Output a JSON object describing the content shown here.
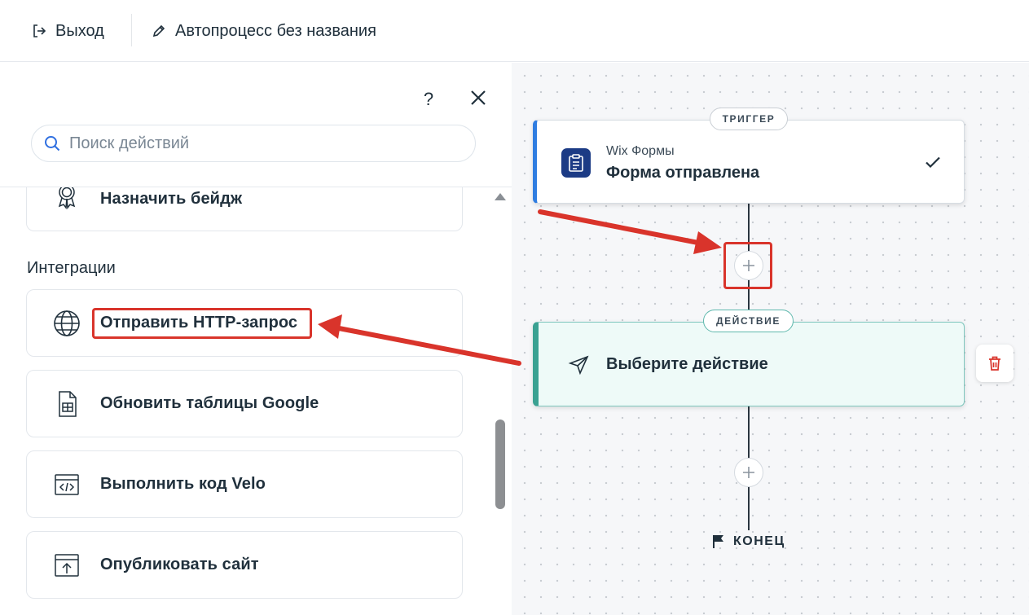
{
  "topbar": {
    "exit_label": "Выход",
    "title": "Автопроцесс без названия"
  },
  "panel": {
    "help_label": "?",
    "search": {
      "placeholder": "Поиск действий",
      "value": ""
    },
    "items_top": [
      {
        "label": "Назначить бейдж",
        "icon": "badge-icon"
      }
    ],
    "section_integrations": "Интеграции",
    "integrations": [
      {
        "label": "Отправить HTTP-запрос",
        "icon": "globe-icon",
        "highlighted": true
      },
      {
        "label": "Обновить таблицы Google",
        "icon": "sheet-icon"
      },
      {
        "label": "Выполнить код Velo",
        "icon": "code-icon"
      },
      {
        "label": "Опубликовать сайт",
        "icon": "publish-icon"
      }
    ]
  },
  "canvas": {
    "trigger": {
      "pill": "ТРИГГЕР",
      "app": "Wix Формы",
      "title": "Форма отправлена"
    },
    "action": {
      "pill": "ДЕЙСТВИЕ",
      "title": "Выберите действие"
    },
    "end_label": "КОНЕЦ"
  },
  "colors": {
    "highlight": "#d9342b",
    "trigger_accent": "#2f7de1",
    "action_accent": "#3aa192",
    "action_bg": "#eefaf8",
    "trash": "#d9342b"
  }
}
